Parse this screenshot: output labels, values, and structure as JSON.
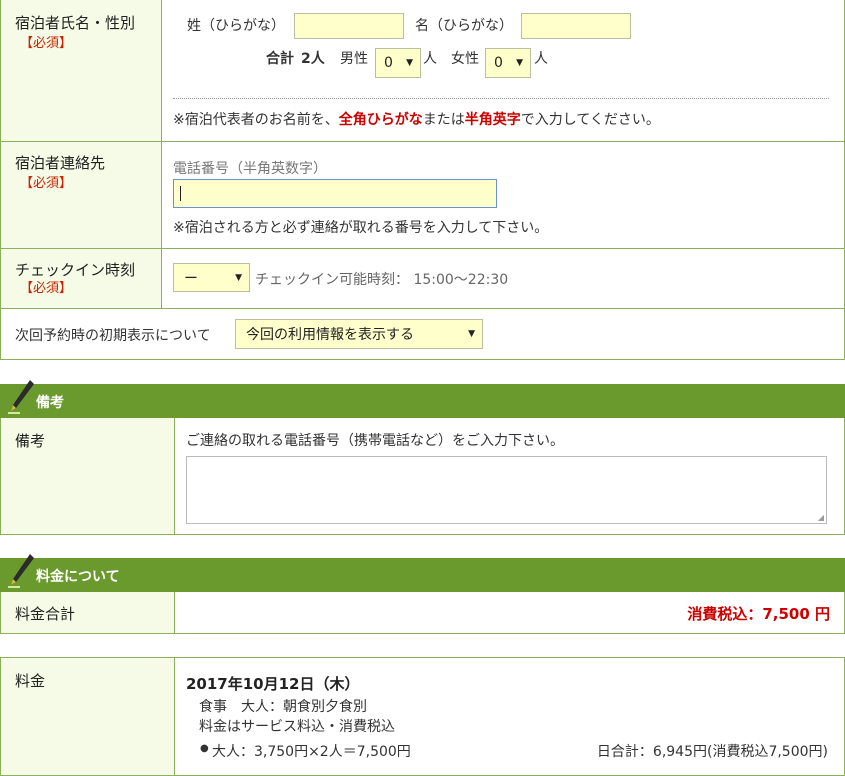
{
  "guest_name": {
    "label": "宿泊者氏名・性別",
    "required": "【必須】",
    "surname_label": "姓（ひらがな）",
    "given_label": "名（ひらがな）",
    "total_label": "合計",
    "total_value": "2人",
    "male_label": "男性",
    "male_value": "0",
    "female_label": "女性",
    "female_value": "0",
    "person_unit": "人",
    "note_prefix": "※宿泊代表者のお名前を、",
    "note_hiragana": "全角ひらがな",
    "note_mid": "または",
    "note_alnum": "半角英字",
    "note_suffix": "で入力してください。"
  },
  "contact": {
    "label": "宿泊者連絡先",
    "required": "【必須】",
    "phone_label": "電話番号（半角英数字）",
    "phone_value": "",
    "note": "※宿泊される方と必ず連絡が取れる番号を入力して下さい。"
  },
  "checkin": {
    "label": "チェックイン時刻",
    "required": "【必須】",
    "selected": "ー",
    "hint": "チェックイン可能時刻： 15:00〜22:30"
  },
  "next_display": {
    "label": "次回予約時の初期表示について",
    "selected": "今回の利用情報を表示する"
  },
  "remarks_section": {
    "title": "備考",
    "row_label": "備考",
    "instruction": "ご連絡の取れる電話番号（携帯電話など）をご入力下さい。",
    "textarea_value": ""
  },
  "fee_section": {
    "title": "料金について",
    "total_label": "料金合計",
    "total_value": "消費税込：7,500 円"
  },
  "fee_detail": {
    "label": "料金",
    "date": "2017年10月12日（木）",
    "meal": "食事　大人：朝食別夕食別",
    "tax_note": "料金はサービス料込・消費税込",
    "breakdown": "大人：3,750円×2人＝7,500円",
    "day_total": "日合計：6,945円(消費税込7,500円)"
  },
  "colors": {
    "accent_green": "#6a9a2d",
    "label_bg": "#f5fbe6",
    "input_bg": "#ffffcc",
    "required_red": "#cc2200"
  }
}
